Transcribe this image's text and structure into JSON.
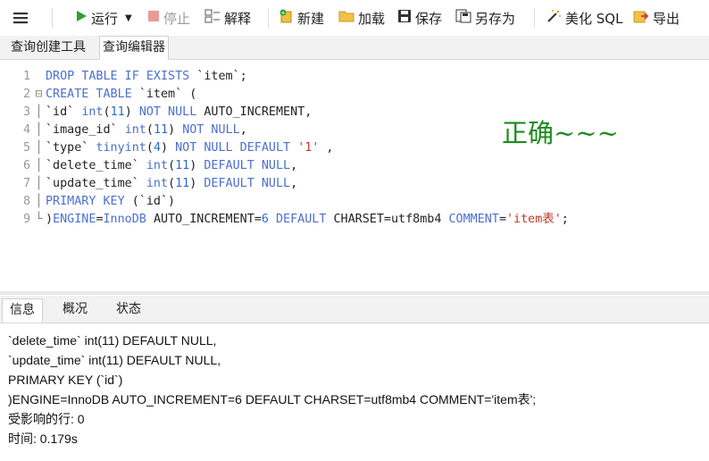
{
  "toolbar": {
    "run": "运行",
    "stop": "停止",
    "explain": "解释",
    "new": "新建",
    "load": "加载",
    "save": "保存",
    "save_as": "另存为",
    "beautify": "美化 SQL",
    "export": "导出"
  },
  "tabs": [
    "查询创建工具",
    "查询编辑器"
  ],
  "code_lines": [
    {
      "n": "1",
      "g": " ",
      "tokens": [
        [
          "kw",
          "DROP TABLE IF EXISTS "
        ],
        [
          "id",
          "`item`;"
        ]
      ]
    },
    {
      "n": "2",
      "g": "⊟",
      "tokens": [
        [
          "kw",
          "CREATE TABLE "
        ],
        [
          "id",
          "`item` ("
        ]
      ]
    },
    {
      "n": "3",
      "g": "│",
      "tokens": [
        [
          "id",
          "`id` "
        ],
        [
          "kw",
          "int"
        ],
        [
          "id",
          "("
        ],
        [
          "num",
          "11"
        ],
        [
          "id",
          ") "
        ],
        [
          "kw",
          "NOT NULL "
        ],
        [
          "id",
          "AUTO_INCREMENT,"
        ]
      ]
    },
    {
      "n": "4",
      "g": "│",
      "tokens": [
        [
          "id",
          "`image_id` "
        ],
        [
          "kw",
          "int"
        ],
        [
          "id",
          "("
        ],
        [
          "num",
          "11"
        ],
        [
          "id",
          ") "
        ],
        [
          "kw",
          "NOT NULL"
        ],
        [
          "id",
          ","
        ]
      ]
    },
    {
      "n": "5",
      "g": "│",
      "tokens": [
        [
          "id",
          "`type` "
        ],
        [
          "kw",
          "tinyint"
        ],
        [
          "id",
          "("
        ],
        [
          "num",
          "4"
        ],
        [
          "id",
          ") "
        ],
        [
          "kw",
          "NOT NULL DEFAULT "
        ],
        [
          "str",
          "'1'"
        ],
        [
          "id",
          " ,"
        ]
      ]
    },
    {
      "n": "6",
      "g": "│",
      "tokens": [
        [
          "id",
          "`delete_time` "
        ],
        [
          "kw",
          "int"
        ],
        [
          "id",
          "("
        ],
        [
          "num",
          "11"
        ],
        [
          "id",
          ") "
        ],
        [
          "kw",
          "DEFAULT NULL"
        ],
        [
          "id",
          ","
        ]
      ]
    },
    {
      "n": "7",
      "g": "│",
      "tokens": [
        [
          "id",
          "`update_time` "
        ],
        [
          "kw",
          "int"
        ],
        [
          "id",
          "("
        ],
        [
          "num",
          "11"
        ],
        [
          "id",
          ") "
        ],
        [
          "kw",
          "DEFAULT NULL"
        ],
        [
          "id",
          ","
        ]
      ]
    },
    {
      "n": "8",
      "g": "│",
      "tokens": [
        [
          "kw",
          "PRIMARY KEY "
        ],
        [
          "id",
          "(`id`)"
        ]
      ]
    },
    {
      "n": "9",
      "g": "└",
      "tokens": [
        [
          "id",
          ")"
        ],
        [
          "kw",
          "ENGINE"
        ],
        [
          "id",
          "="
        ],
        [
          "kw",
          "InnoDB "
        ],
        [
          "id",
          "AUTO_INCREMENT="
        ],
        [
          "num",
          "6"
        ],
        [
          "id",
          " "
        ],
        [
          "kw",
          "DEFAULT "
        ],
        [
          "id",
          "CHARSET=utf8mb4 "
        ],
        [
          "kw",
          "COMMENT"
        ],
        [
          "id",
          "="
        ],
        [
          "str",
          "'item表'"
        ],
        [
          "id",
          ";"
        ]
      ]
    }
  ],
  "annotation": "正确~~~",
  "bottom_tabs": [
    "信息",
    "概况",
    "状态"
  ],
  "output_lines": [
    "`delete_time` int(11) DEFAULT NULL,",
    "`update_time` int(11) DEFAULT NULL,",
    "PRIMARY KEY (`id`)",
    ")ENGINE=InnoDB AUTO_INCREMENT=6 DEFAULT CHARSET=utf8mb4 COMMENT='item表';",
    "受影响的行: 0",
    "时间: 0.179s"
  ],
  "colors": {
    "keyword": "#4b6fd1",
    "string": "#c0392b",
    "annotation": "#1f8a1f",
    "run_icon": "#2ea02e",
    "stop_icon": "#e06666"
  }
}
